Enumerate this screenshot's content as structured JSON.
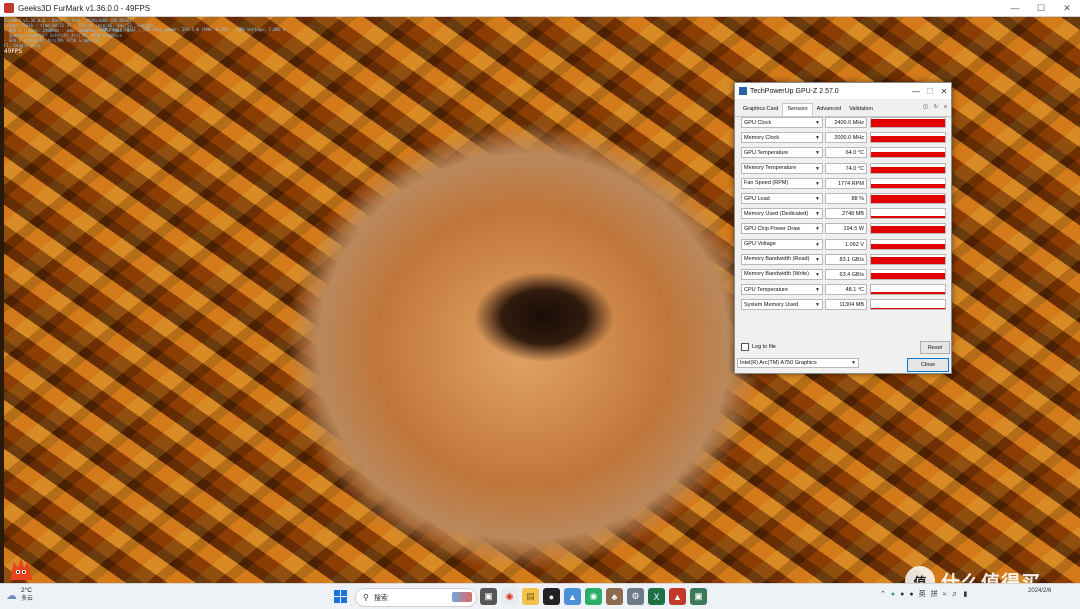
{
  "furmark": {
    "title": "Geeks3D FurMark v1.36.0.0 - 49FPS",
    "osd_lines": [
      "FurMark v1.36.0.0 - Burn-in test, 1920x1080 (0X MSAA)",
      "Frames:75010 - time:00:25:37 - FPS:49 (min:46, max:52, avg:48)",
      "[ GPU-Z ] core: 2400MHz - mem: 2000MHz - GPU load: 88% ...",
      "- OpenGL renderer: Intel(R) Arc(TM) A750 Graphics",
      "- GPU 1 (Intel(R) Arc(TM) A750 Graphics)",
      "F1: toggle help"
    ],
    "fps_text": "49FPS",
    "gpu_status_line": "GPU temp: 64 °C - GPU chip power: 194.5 W (PPW: 0.252) - GPU voltage: 1.092 V"
  },
  "gpuz": {
    "title": "TechPowerUp GPU-Z 2.57.0",
    "tabs": [
      "Graphics Card",
      "Sensors",
      "Advanced",
      "Validation"
    ],
    "active_tab": "Sensors",
    "sensors": [
      {
        "name": "GPU Clock",
        "value": "2400.0 MHz",
        "fill": 0.95
      },
      {
        "name": "Memory Clock",
        "value": "2000.0 MHz",
        "fill": 0.7
      },
      {
        "name": "GPU Temperature",
        "value": "64.0 °C",
        "fill": 0.6
      },
      {
        "name": "Memory Temperature",
        "value": "74.0 °C",
        "fill": 0.6
      },
      {
        "name": "Fan Speed (RPM)",
        "value": "1774 RPM",
        "fill": 0.45
      },
      {
        "name": "GPU Load",
        "value": "88 %",
        "fill": 0.88
      },
      {
        "name": "Memory Used (Dedicated)",
        "value": "2748 MB",
        "fill": 0.3
      },
      {
        "name": "GPU Chip Power Draw",
        "value": "194.5 W",
        "fill": 0.85
      },
      {
        "name": "GPU Voltage",
        "value": "1.092 V",
        "fill": 0.55
      },
      {
        "name": "Memory Bandwidth (Read)",
        "value": "83.1 GB/s",
        "fill": 0.75
      },
      {
        "name": "Memory Bandwidth (Write)",
        "value": "63.4 GB/s",
        "fill": 0.7
      },
      {
        "name": "CPU Temperature",
        "value": "48.1 °C",
        "fill": 0.25
      },
      {
        "name": "System Memory Used",
        "value": "11304 MB",
        "fill": 0.15
      }
    ],
    "log_label": "Log to file",
    "reset_label": "Reset",
    "device": "Intel(R) Arc(TM) A750 Graphics",
    "close_label": "Close",
    "graph_color": "#e30000"
  },
  "taskbar": {
    "temperature": "2°C",
    "condition": "多云",
    "search_placeholder": "搜索",
    "ime_label": "英",
    "ime_mode": "拼",
    "time": "",
    "date": "2024/2/6"
  },
  "watermark": {
    "logo_char": "值",
    "text": "什么值得买"
  }
}
